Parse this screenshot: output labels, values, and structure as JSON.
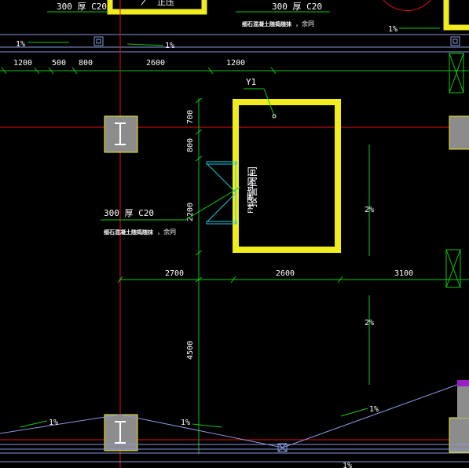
{
  "colors": {
    "background": "#000000",
    "axis_red": "#e01010",
    "dim_green": "#12c812",
    "wall_yellow": "#f0ec1e",
    "pipe_blue": "#8899dd",
    "door_cyan": "#20c8d8",
    "text_white": "#ffffff",
    "column_fill": "#8c8c8c",
    "slab_purple": "#9b1ec8"
  },
  "top_strip": {
    "slab_note_left": "300  厚 C20",
    "slab_note_right": "300  厚 C20",
    "material_note_right": "细石混凝土随捣随抹",
    "material_suffix_right": "，余同",
    "slope_left_a": "1%",
    "slope_left_b": "1%",
    "slope_right": "1%",
    "fragment_text": "正压"
  },
  "dimensions_top": [
    "1200",
    "500",
    "800",
    "2600",
    "1200"
  ],
  "room": {
    "tag": "Y1",
    "name": "报警阀间",
    "door_code": "FM 甲 1521"
  },
  "dimensions_vertical_left": [
    "700",
    "800",
    "2200"
  ],
  "slab_note": {
    "thickness": "300  厚 C20",
    "material": "细石混凝土随捣随抹",
    "suffix": "，余同"
  },
  "dimensions_mid": [
    "2700",
    "2600",
    "3100"
  ],
  "dimension_lower_vertical": "4500",
  "slopes": {
    "right_upper": "2%",
    "right_lower": "2%",
    "bottom_left": "1%",
    "bottom_mid": "1%",
    "bottom_right": "1%",
    "bottom_edge": "1%"
  }
}
